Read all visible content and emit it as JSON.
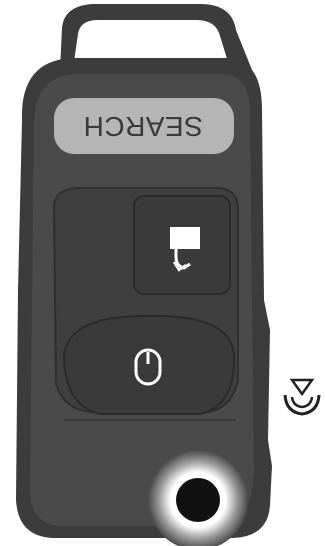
{
  "remote": {
    "search_button": {
      "label": "SEARCH"
    },
    "icons": {
      "upper_button": "remote-start-icon",
      "lower_button": "mouse-icon",
      "key_hole": "key-cylinder-icon",
      "side_symbol": "signal-arrow-icon"
    },
    "colors": {
      "body_outer": "#3c3c3c",
      "body_inner": "#4a4a4a",
      "button_dark": "#3a3a3a",
      "button_light": "#b5b5b5",
      "icon_white": "#ffffff",
      "key_hole": "#111111"
    }
  }
}
